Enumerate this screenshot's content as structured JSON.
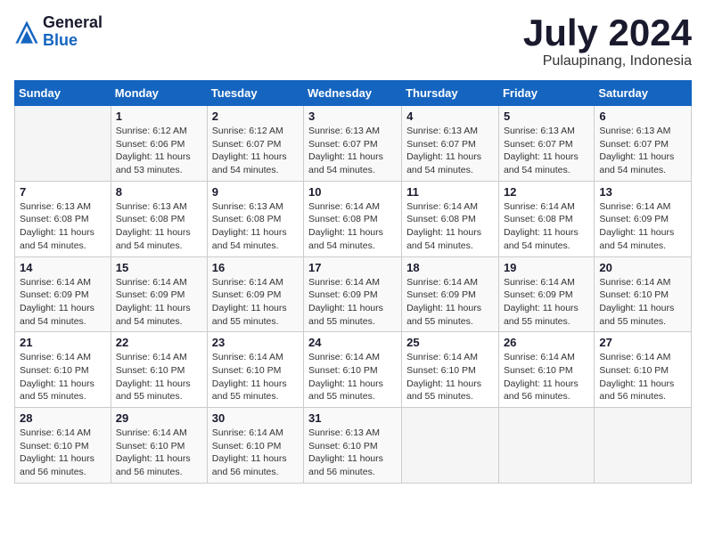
{
  "logo": {
    "general": "General",
    "blue": "Blue"
  },
  "title": "July 2024",
  "subtitle": "Pulaupinang, Indonesia",
  "days_of_week": [
    "Sunday",
    "Monday",
    "Tuesday",
    "Wednesday",
    "Thursday",
    "Friday",
    "Saturday"
  ],
  "weeks": [
    [
      {
        "day": "",
        "sunrise": "",
        "sunset": "",
        "daylight": ""
      },
      {
        "day": "1",
        "sunrise": "Sunrise: 6:12 AM",
        "sunset": "Sunset: 6:06 PM",
        "daylight": "Daylight: 11 hours and 53 minutes."
      },
      {
        "day": "2",
        "sunrise": "Sunrise: 6:12 AM",
        "sunset": "Sunset: 6:07 PM",
        "daylight": "Daylight: 11 hours and 54 minutes."
      },
      {
        "day": "3",
        "sunrise": "Sunrise: 6:13 AM",
        "sunset": "Sunset: 6:07 PM",
        "daylight": "Daylight: 11 hours and 54 minutes."
      },
      {
        "day": "4",
        "sunrise": "Sunrise: 6:13 AM",
        "sunset": "Sunset: 6:07 PM",
        "daylight": "Daylight: 11 hours and 54 minutes."
      },
      {
        "day": "5",
        "sunrise": "Sunrise: 6:13 AM",
        "sunset": "Sunset: 6:07 PM",
        "daylight": "Daylight: 11 hours and 54 minutes."
      },
      {
        "day": "6",
        "sunrise": "Sunrise: 6:13 AM",
        "sunset": "Sunset: 6:07 PM",
        "daylight": "Daylight: 11 hours and 54 minutes."
      }
    ],
    [
      {
        "day": "7",
        "sunrise": "Sunrise: 6:13 AM",
        "sunset": "Sunset: 6:08 PM",
        "daylight": "Daylight: 11 hours and 54 minutes."
      },
      {
        "day": "8",
        "sunrise": "Sunrise: 6:13 AM",
        "sunset": "Sunset: 6:08 PM",
        "daylight": "Daylight: 11 hours and 54 minutes."
      },
      {
        "day": "9",
        "sunrise": "Sunrise: 6:13 AM",
        "sunset": "Sunset: 6:08 PM",
        "daylight": "Daylight: 11 hours and 54 minutes."
      },
      {
        "day": "10",
        "sunrise": "Sunrise: 6:14 AM",
        "sunset": "Sunset: 6:08 PM",
        "daylight": "Daylight: 11 hours and 54 minutes."
      },
      {
        "day": "11",
        "sunrise": "Sunrise: 6:14 AM",
        "sunset": "Sunset: 6:08 PM",
        "daylight": "Daylight: 11 hours and 54 minutes."
      },
      {
        "day": "12",
        "sunrise": "Sunrise: 6:14 AM",
        "sunset": "Sunset: 6:08 PM",
        "daylight": "Daylight: 11 hours and 54 minutes."
      },
      {
        "day": "13",
        "sunrise": "Sunrise: 6:14 AM",
        "sunset": "Sunset: 6:09 PM",
        "daylight": "Daylight: 11 hours and 54 minutes."
      }
    ],
    [
      {
        "day": "14",
        "sunrise": "Sunrise: 6:14 AM",
        "sunset": "Sunset: 6:09 PM",
        "daylight": "Daylight: 11 hours and 54 minutes."
      },
      {
        "day": "15",
        "sunrise": "Sunrise: 6:14 AM",
        "sunset": "Sunset: 6:09 PM",
        "daylight": "Daylight: 11 hours and 54 minutes."
      },
      {
        "day": "16",
        "sunrise": "Sunrise: 6:14 AM",
        "sunset": "Sunset: 6:09 PM",
        "daylight": "Daylight: 11 hours and 55 minutes."
      },
      {
        "day": "17",
        "sunrise": "Sunrise: 6:14 AM",
        "sunset": "Sunset: 6:09 PM",
        "daylight": "Daylight: 11 hours and 55 minutes."
      },
      {
        "day": "18",
        "sunrise": "Sunrise: 6:14 AM",
        "sunset": "Sunset: 6:09 PM",
        "daylight": "Daylight: 11 hours and 55 minutes."
      },
      {
        "day": "19",
        "sunrise": "Sunrise: 6:14 AM",
        "sunset": "Sunset: 6:09 PM",
        "daylight": "Daylight: 11 hours and 55 minutes."
      },
      {
        "day": "20",
        "sunrise": "Sunrise: 6:14 AM",
        "sunset": "Sunset: 6:10 PM",
        "daylight": "Daylight: 11 hours and 55 minutes."
      }
    ],
    [
      {
        "day": "21",
        "sunrise": "Sunrise: 6:14 AM",
        "sunset": "Sunset: 6:10 PM",
        "daylight": "Daylight: 11 hours and 55 minutes."
      },
      {
        "day": "22",
        "sunrise": "Sunrise: 6:14 AM",
        "sunset": "Sunset: 6:10 PM",
        "daylight": "Daylight: 11 hours and 55 minutes."
      },
      {
        "day": "23",
        "sunrise": "Sunrise: 6:14 AM",
        "sunset": "Sunset: 6:10 PM",
        "daylight": "Daylight: 11 hours and 55 minutes."
      },
      {
        "day": "24",
        "sunrise": "Sunrise: 6:14 AM",
        "sunset": "Sunset: 6:10 PM",
        "daylight": "Daylight: 11 hours and 55 minutes."
      },
      {
        "day": "25",
        "sunrise": "Sunrise: 6:14 AM",
        "sunset": "Sunset: 6:10 PM",
        "daylight": "Daylight: 11 hours and 55 minutes."
      },
      {
        "day": "26",
        "sunrise": "Sunrise: 6:14 AM",
        "sunset": "Sunset: 6:10 PM",
        "daylight": "Daylight: 11 hours and 56 minutes."
      },
      {
        "day": "27",
        "sunrise": "Sunrise: 6:14 AM",
        "sunset": "Sunset: 6:10 PM",
        "daylight": "Daylight: 11 hours and 56 minutes."
      }
    ],
    [
      {
        "day": "28",
        "sunrise": "Sunrise: 6:14 AM",
        "sunset": "Sunset: 6:10 PM",
        "daylight": "Daylight: 11 hours and 56 minutes."
      },
      {
        "day": "29",
        "sunrise": "Sunrise: 6:14 AM",
        "sunset": "Sunset: 6:10 PM",
        "daylight": "Daylight: 11 hours and 56 minutes."
      },
      {
        "day": "30",
        "sunrise": "Sunrise: 6:14 AM",
        "sunset": "Sunset: 6:10 PM",
        "daylight": "Daylight: 11 hours and 56 minutes."
      },
      {
        "day": "31",
        "sunrise": "Sunrise: 6:13 AM",
        "sunset": "Sunset: 6:10 PM",
        "daylight": "Daylight: 11 hours and 56 minutes."
      },
      {
        "day": "",
        "sunrise": "",
        "sunset": "",
        "daylight": ""
      },
      {
        "day": "",
        "sunrise": "",
        "sunset": "",
        "daylight": ""
      },
      {
        "day": "",
        "sunrise": "",
        "sunset": "",
        "daylight": ""
      }
    ]
  ]
}
